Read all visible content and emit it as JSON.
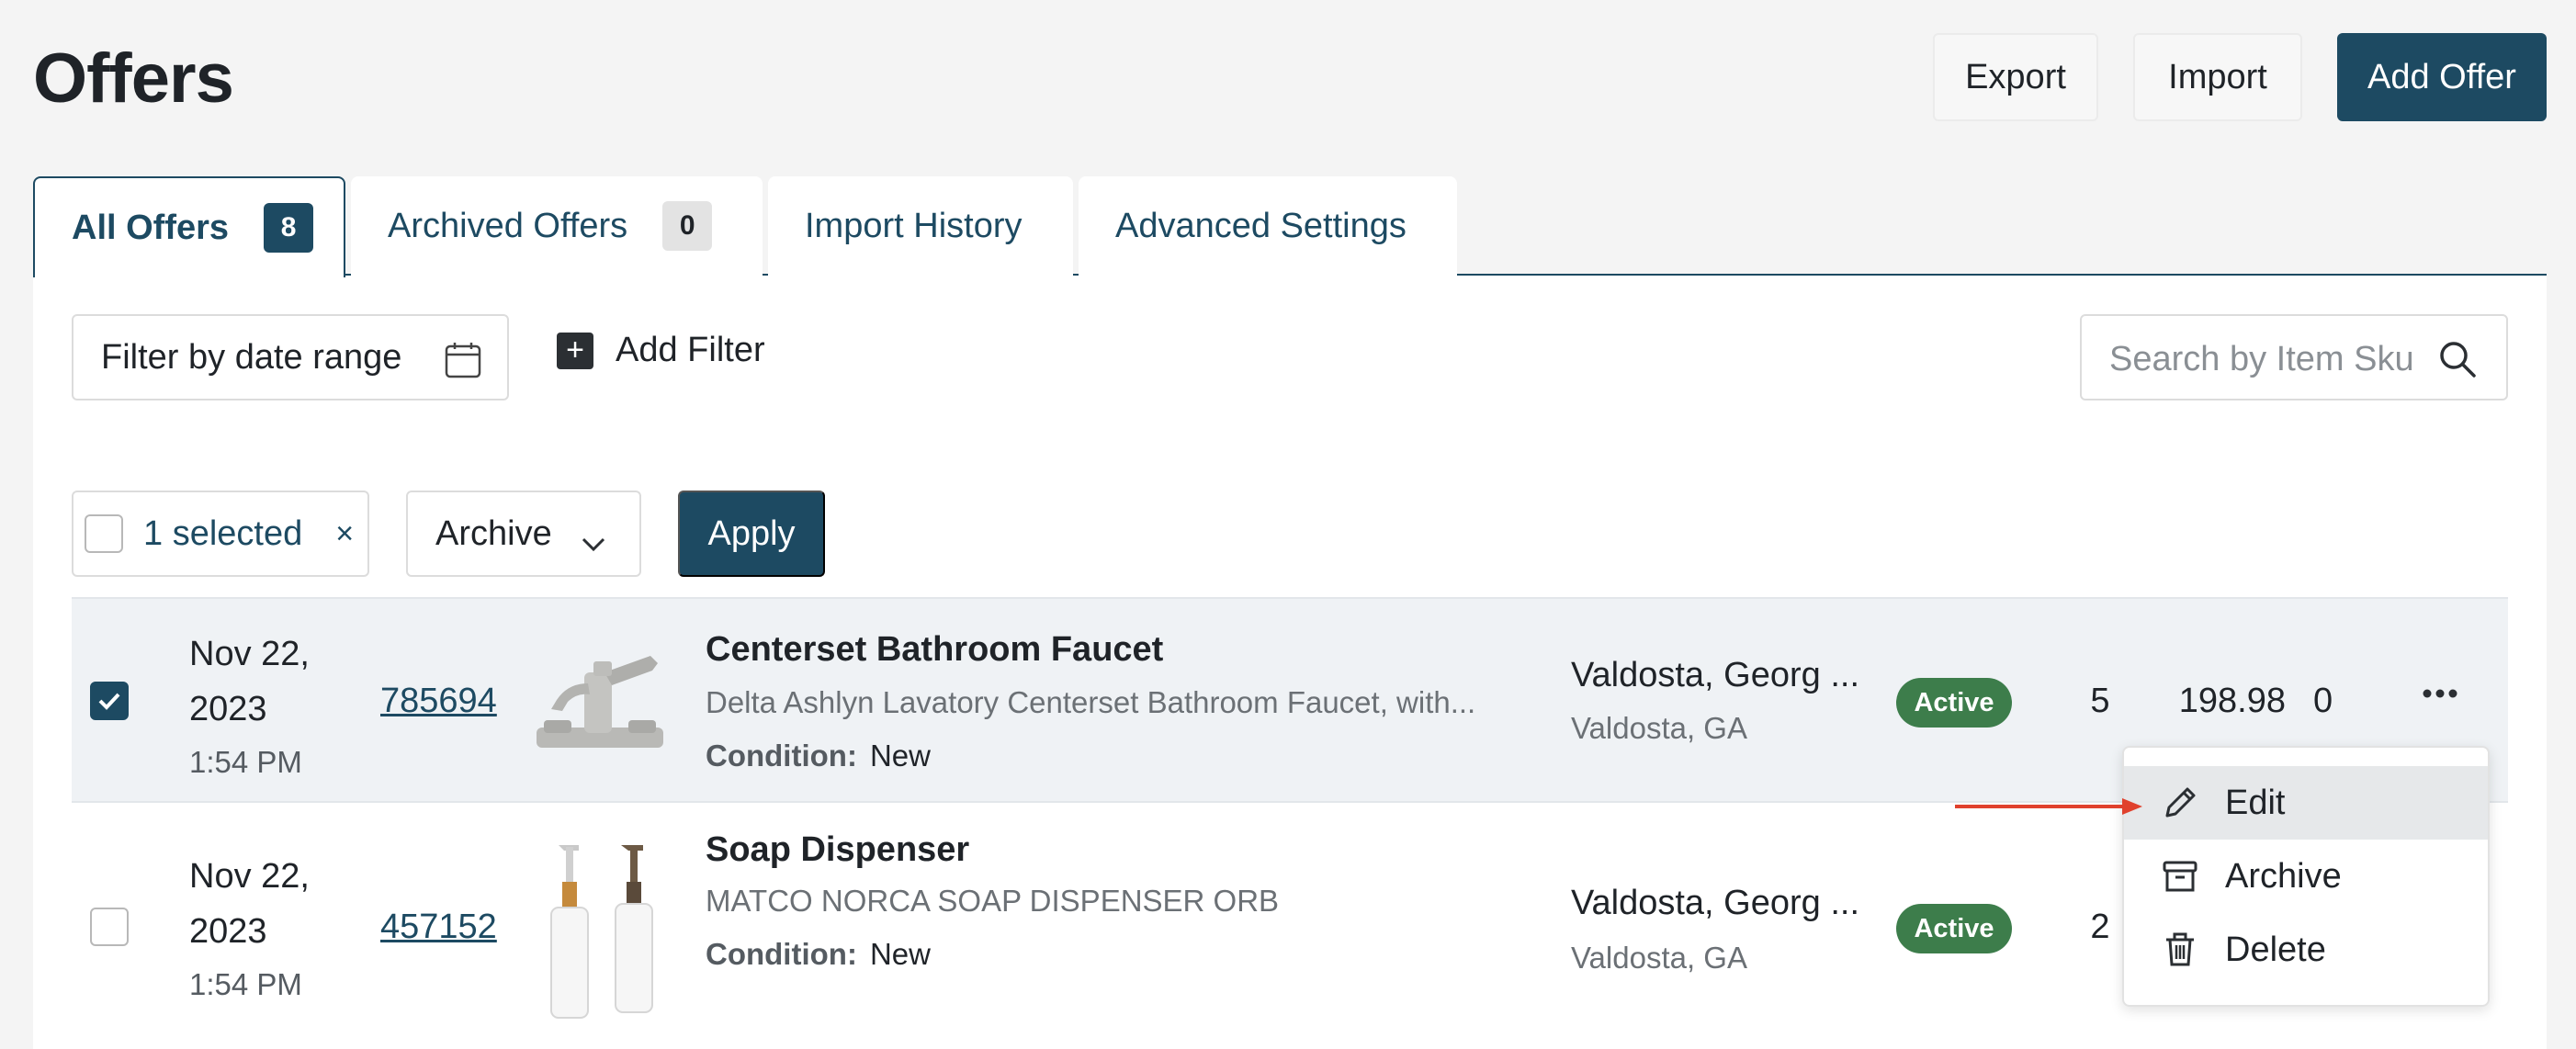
{
  "header": {
    "title": "Offers",
    "export_label": "Export",
    "import_label": "Import",
    "add_offer_label": "Add Offer"
  },
  "tabs": [
    {
      "label": "All Offers",
      "count": "8",
      "active": true
    },
    {
      "label": "Archived Offers",
      "count": "0",
      "active": false
    },
    {
      "label": "Import History",
      "active": false
    },
    {
      "label": "Advanced Settings",
      "active": false
    }
  ],
  "filters": {
    "date_range_label": "Filter by date range",
    "add_filter_label": "Add Filter",
    "search_placeholder": "Search by Item Sku"
  },
  "bulk": {
    "selected_label": "1 selected",
    "clear_symbol": "×",
    "action_value": "Archive",
    "apply_label": "Apply"
  },
  "rows": [
    {
      "selected": true,
      "date_line1": "Nov 22,",
      "date_line2": "2023",
      "time": "1:54 PM",
      "sku": "785694",
      "title": "Centerset Bathroom Faucet",
      "description": "Delta Ashlyn Lavatory Centerset Bathroom Faucet, with...",
      "condition_label": "Condition:",
      "condition": "New",
      "location": "Valdosta, Georg ...",
      "location_sub": "Valdosta, GA",
      "status": "Active",
      "quantity": "5",
      "price": "198.98",
      "extra": "0"
    },
    {
      "selected": false,
      "date_line1": "Nov 22,",
      "date_line2": "2023",
      "time": "1:54 PM",
      "sku": "457152",
      "title": "Soap Dispenser",
      "description": "MATCO NORCA SOAP DISPENSER ORB",
      "condition_label": "Condition:",
      "condition": "New",
      "location": "Valdosta, Georg ...",
      "location_sub": "Valdosta, GA",
      "status": "Active",
      "quantity": "2"
    }
  ],
  "row_menu": {
    "items": [
      {
        "label": "Edit",
        "icon": "pencil-icon",
        "highlighted": true
      },
      {
        "label": "Archive",
        "icon": "archive-box-icon"
      },
      {
        "label": "Delete",
        "icon": "trash-icon"
      }
    ]
  },
  "colors": {
    "primary": "#1d4a62",
    "status_active": "#3d7d4b",
    "annotation_arrow": "#e0412d"
  }
}
